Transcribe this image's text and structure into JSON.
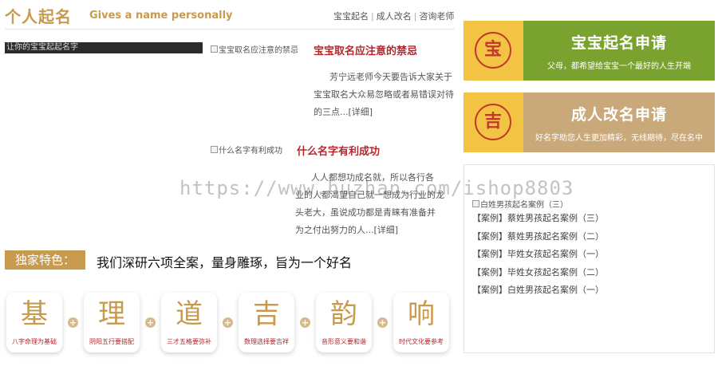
{
  "header": {
    "title": "个人起名",
    "subtitle": "Gives a name personally",
    "links": [
      "宝宝起名",
      "成人改名",
      "咨询老师"
    ]
  },
  "dark_image_text": "让你的宝宝起起名字",
  "articles": [
    {
      "img_alt": "宝宝取名应注意的禁忌",
      "title": "宝宝取名应注意的禁忌",
      "lines": [
        "芳宁远老师今天要告诉大家关于",
        "宝宝取名大众易忽略或者易错误对待",
        "的三点...[详细]"
      ]
    },
    {
      "img_alt": "什么名字有利成功",
      "title": "什么名字有利成功",
      "lines": [
        "人人都想功成名就，所以各行各",
        "业的人都渴望自己就一想成为行业的龙",
        "头老大，虽说成功都是青睐有准备并",
        "为之付出努力的人...[详细]"
      ]
    }
  ],
  "feature": {
    "label": "独家特色：",
    "text": "我们深研六项全案，量身雕琢，旨为一个好名"
  },
  "cards": [
    {
      "char": "基",
      "desc": "八字命理为基础"
    },
    {
      "char": "理",
      "desc": "阴阳五行要搭配"
    },
    {
      "char": "道",
      "desc": "三才五格要弥补"
    },
    {
      "char": "吉",
      "desc": "数理选择要吉祥"
    },
    {
      "char": "韵",
      "desc": "音形意义要和谐"
    },
    {
      "char": "响",
      "desc": "时代文化要参考"
    }
  ],
  "plus_symbol": "+",
  "apply_blocks": [
    {
      "badge": "宝",
      "title": "宝宝起名申请",
      "desc": "父母，都希望给宝宝一个最好的人生开端",
      "color": "#7aa22f"
    },
    {
      "badge": "吉",
      "title": "成人改名申请",
      "desc": "好名字助您人生更加精彩，无线期待，尽在名中",
      "color": "#c9a87a"
    }
  ],
  "case_list": {
    "img_alt": "白姓男孩起名案例（三）",
    "items": [
      "【案例】蔡姓男孩起名案例（三）",
      "【案例】蔡姓男孩起名案例（二）",
      "【案例】毕姓女孩起名案例（一）",
      "【案例】毕姓女孩起名案例（二）",
      "【案例】白姓男孩起名案例（一）"
    ]
  },
  "watermark": "https://www.huzhan.com/ishop8803",
  "colors": {
    "gold": "#c79a4e",
    "red": "#b3282d",
    "green": "#7aa22f",
    "tan": "#c9a87a",
    "yellow": "#f3c344"
  }
}
